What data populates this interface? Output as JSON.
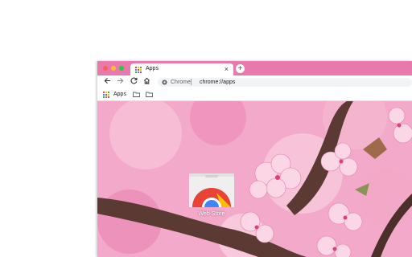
{
  "colors": {
    "tabstrip": "#e879ad",
    "tab": "#ffffff",
    "omnibox": "#f1f3f4",
    "wallpaper_pink": "#f3a9c9",
    "branch": "#5a3a32"
  },
  "tab": {
    "title": "Apps",
    "icon": "apps-grid-icon"
  },
  "toolbar": {
    "back_icon": "arrow-left-icon",
    "forward_icon": "arrow-right-icon",
    "reload_icon": "reload-icon",
    "home_icon": "home-icon"
  },
  "omnibox": {
    "chip": "Chrome",
    "url": "chrome://apps"
  },
  "bookmarks": {
    "items": [
      {
        "label": "Apps",
        "icon": "apps-grid-icon"
      },
      {
        "label": "",
        "icon": "folder-icon"
      },
      {
        "label": "",
        "icon": "folder-icon"
      }
    ]
  },
  "apps": [
    {
      "label": "Web Store",
      "icon": "chrome-web-store-icon"
    }
  ]
}
